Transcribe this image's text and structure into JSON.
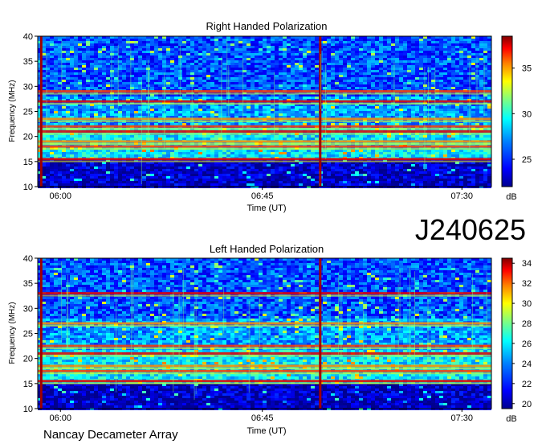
{
  "observation_id": "J240625",
  "footer": "Nancay Decameter Array",
  "colors": {
    "background": "#0a1fa8",
    "colormap": [
      "#00008f",
      "#0000ff",
      "#0080ff",
      "#00ffff",
      "#80ff80",
      "#ffff00",
      "#ff8000",
      "#ff0000",
      "#800000"
    ]
  },
  "chart_data": [
    {
      "type": "heatmap",
      "title": "Right Handed Polarization",
      "xlabel": "Time (UT)",
      "ylabel": "Frequency (MHz)",
      "x_ticks": [
        "06:00",
        "06:45",
        "07:30"
      ],
      "y_ticks": [
        10,
        15,
        20,
        25,
        30,
        35,
        40
      ],
      "ylim": [
        10,
        40
      ],
      "colorbar": {
        "label": "dB",
        "ticks": [
          25,
          30,
          35
        ],
        "range": [
          22,
          38.5
        ]
      },
      "quiet_band_mhz": [
        10,
        15.5
      ],
      "strong_bands_mhz": [
        15.5,
        18,
        19,
        21,
        22,
        23.5,
        27,
        29
      ],
      "time_bursts": [
        0.005,
        0.62
      ]
    },
    {
      "type": "heatmap",
      "title": "Left Handed Polarization",
      "xlabel": "Time (UT)",
      "ylabel": "Frequency (MHz)",
      "x_ticks": [
        "06:00",
        "06:45",
        "07:30"
      ],
      "y_ticks": [
        10,
        15,
        20,
        25,
        30,
        35,
        40
      ],
      "ylim": [
        10,
        40
      ],
      "colorbar": {
        "label": "dB",
        "ticks": [
          20,
          22,
          24,
          26,
          28,
          30,
          32,
          34
        ],
        "range": [
          19.5,
          34.5
        ]
      },
      "quiet_band_mhz": [
        10,
        15
      ],
      "strong_bands_mhz": [
        15.5,
        17.5,
        18.5,
        21,
        22.5,
        27,
        33
      ],
      "time_bursts": [
        0.005,
        0.62
      ]
    }
  ]
}
